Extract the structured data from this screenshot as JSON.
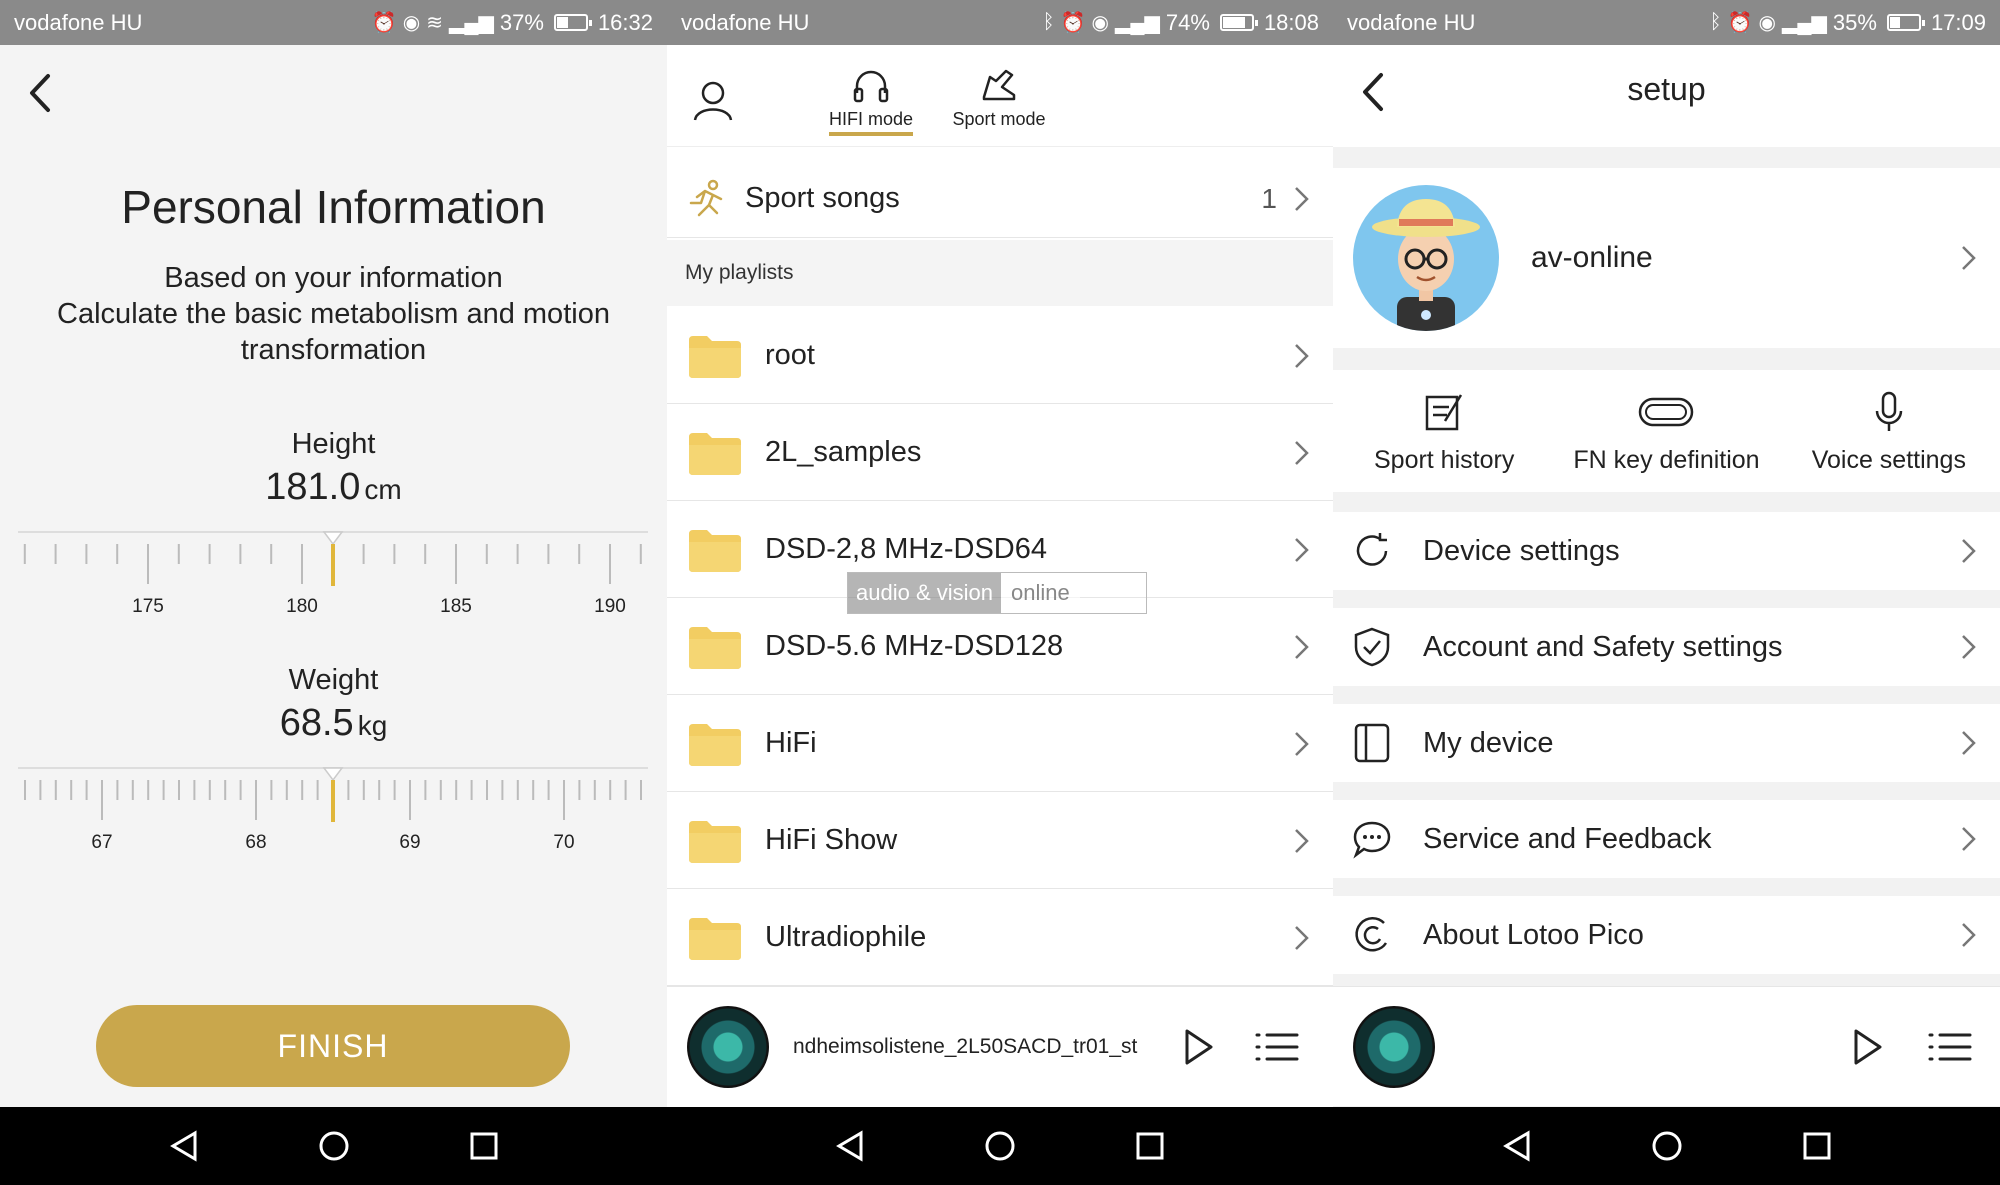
{
  "screen1": {
    "status": {
      "carrier": "vodafone HU",
      "battery": "37%",
      "battery_level": 0.37,
      "time": "16:32"
    },
    "title": "Personal Information",
    "description_lines": [
      "Based on your information",
      "Calculate the basic metabolism and motion",
      "transformation"
    ],
    "height": {
      "label": "Height",
      "value": "181.0",
      "unit": "cm",
      "ticks": [
        "175",
        "180",
        "185",
        "190"
      ]
    },
    "weight": {
      "label": "Weight",
      "value": "68.5",
      "unit": "kg",
      "ticks": [
        "67",
        "68",
        "69",
        "70"
      ]
    },
    "finish_label": "FINISH"
  },
  "screen2": {
    "status": {
      "carrier": "vodafone HU",
      "battery": "74%",
      "battery_level": 0.74,
      "time": "18:08"
    },
    "modes": [
      {
        "label": "HIFI mode",
        "icon": "headphones-icon",
        "active": true
      },
      {
        "label": "Sport mode",
        "icon": "shoe-icon",
        "active": false
      }
    ],
    "sport_songs": {
      "label": "Sport songs",
      "count": "1"
    },
    "section_label": "My playlists",
    "playlists": [
      "root",
      "2L_samples",
      "DSD-2,8 MHz-DSD64",
      "DSD-5.6 MHz-DSD128",
      "HiFi",
      "HiFi Show",
      "Ultradiophile"
    ],
    "watermark": {
      "left": "audio & vision",
      "right": "online"
    },
    "player": {
      "track": "ndheimsolistene_2L50SACD_tr01_st"
    }
  },
  "screen3": {
    "status": {
      "carrier": "vodafone HU",
      "battery": "35%",
      "battery_level": 0.35,
      "time": "17:09"
    },
    "title": "setup",
    "username": "av-online",
    "quick_actions": [
      {
        "label": "Sport history",
        "icon": "edit-note-icon"
      },
      {
        "label": "FN key definition",
        "icon": "key-pill-icon"
      },
      {
        "label": "Voice settings",
        "icon": "microphone-icon"
      }
    ],
    "menu": [
      {
        "label": "Device settings",
        "icon": "refresh-icon"
      },
      {
        "label": "Account and Safety settings",
        "icon": "shield-check-icon"
      },
      {
        "label": "My device",
        "icon": "device-icon"
      },
      {
        "label": "Service and Feedback",
        "icon": "chat-icon"
      },
      {
        "label": "About Lotoo Pico",
        "icon": "lotoo-logo-icon"
      }
    ]
  },
  "colors": {
    "accent": "#c9a74c",
    "statusbar": "#8a8a8a",
    "navbar": "#000000"
  }
}
